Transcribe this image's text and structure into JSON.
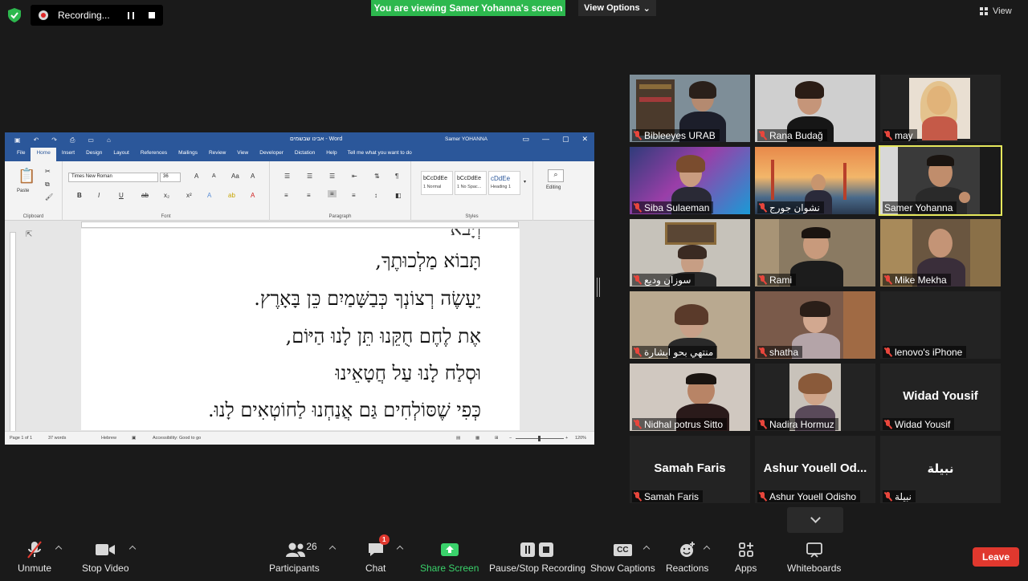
{
  "top_bar": {
    "recording_label": "Recording...",
    "viewing_banner": "You are viewing Samer Yohanna's screen",
    "view_options": "View Options",
    "view_label": "View"
  },
  "word": {
    "quick_access": [
      "▣",
      "↶",
      "↷",
      "⎙",
      "▭",
      "⌂"
    ],
    "doc_title": "אבינו שבשמים - Word",
    "user": "Samer YOHANNA",
    "window_controls": [
      "▭",
      "—",
      "▢",
      "✕"
    ],
    "tabs": [
      "File",
      "Home",
      "Insert",
      "Design",
      "Layout",
      "References",
      "Mailings",
      "Review",
      "View",
      "Developer",
      "Dictation",
      "Help"
    ],
    "tell_me": "Tell me what you want to do",
    "ribbon": {
      "paste": "Paste",
      "clipboard": "Clipboard",
      "font_name": "Times New Roman",
      "font_size": "36",
      "font": "Font",
      "paragraph": "Paragraph",
      "styles": "Styles",
      "editing": "Editing",
      "style_items": [
        {
          "sample": "bCcDdEe",
          "name": "1 Normal"
        },
        {
          "sample": "bCcDdEe",
          "name": "1 No Spac..."
        },
        {
          "sample": "cDdEe",
          "name": "Heading 1"
        }
      ]
    },
    "hebrew_lines": [
      "תָּבוֹא מַלְכוּתֶךָ,",
      "יֵעָשֶׂה רְצוֹנְךָ כְּבַשָּׁמַיִם כֵּן בָּאָרֶץ.",
      "אֶת לֶחֶם חֻקֵּנוּ תֵּן לָנוּ הַיּוֹם,",
      "וּסְלַח לָנוּ עַל חֲטָאֵינוּ",
      "כְּפִי שֶׁסּוֹלְחִים גַּם אֲנַחְנוּ לַחוֹטְאִים לָנוּ."
    ],
    "status": {
      "page": "Page 1 of 1",
      "words": "37 words",
      "language": "Hebrew",
      "accessibility": "Accessibility: Good to go",
      "zoom": "120%"
    }
  },
  "participants": [
    {
      "name": "Bibleeyes URAB",
      "video": true
    },
    {
      "name": "Rana Budağ",
      "video": true
    },
    {
      "name": "may",
      "video": true
    },
    {
      "name": "Siba Sulaeman",
      "video": true
    },
    {
      "name": "نشوان جورج",
      "video": true
    },
    {
      "name": "Samer Yohanna",
      "video": true,
      "speaking": true
    },
    {
      "name": "سوزان وديع",
      "video": true
    },
    {
      "name": "Rami",
      "video": true
    },
    {
      "name": "Mike Mekha",
      "video": true
    },
    {
      "name": "منتهي بحو ابشارة",
      "video": true
    },
    {
      "name": "shatha",
      "video": true
    },
    {
      "name": "lenovo's iPhone",
      "video": false,
      "display": ""
    },
    {
      "name": "Nidhal potrus Sitto",
      "video": true
    },
    {
      "name": "Nadira Hormuz",
      "video": true
    },
    {
      "name": "Widad Yousif",
      "video": false,
      "display": "Widad Yousif"
    },
    {
      "name": "Samah Faris",
      "video": false,
      "display": "Samah Faris"
    },
    {
      "name": "Ashur Youell Odisho",
      "video": false,
      "display": "Ashur Youell Od..."
    },
    {
      "name": "نبيلة",
      "video": false,
      "display": "نبيلة"
    }
  ],
  "toolbar": {
    "unmute": "Unmute",
    "stop_video": "Stop Video",
    "participants": "Participants",
    "participants_count": "26",
    "chat": "Chat",
    "chat_badge": "1",
    "share_screen": "Share Screen",
    "pause_stop_recording": "Pause/Stop Recording",
    "cc": "CC",
    "show_captions": "Show Captions",
    "reactions": "Reactions",
    "apps": "Apps",
    "whiteboards": "Whiteboards",
    "leave": "Leave"
  },
  "colors": {
    "banner_green": "#2db84e",
    "word_blue": "#2b579a",
    "leave_red": "#e0382e",
    "speaker_outline": "#e6e85c"
  }
}
